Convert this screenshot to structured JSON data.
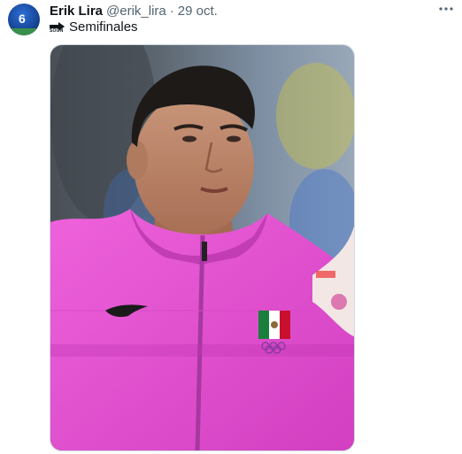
{
  "tweet": {
    "author_name": "Erik Lira",
    "handle": "@erik_lira",
    "separator": "·",
    "date": "29 oct.",
    "soon_icon_label": "SOON",
    "text": "Semifinales"
  },
  "avatar": {
    "jersey_number": "6"
  },
  "icons": {
    "more": "more-horizontal-icon",
    "soon": "soon-arrow-icon"
  },
  "colors": {
    "jacket": "#e24ad0",
    "jacket_shadow": "#b52aa8",
    "text_primary": "#0f1419",
    "text_secondary": "#536471"
  },
  "image": {
    "alt": "Player in pink Mexico jacket",
    "flag_colors": [
      "#1a7f3c",
      "#ffffff",
      "#c8102e"
    ]
  }
}
